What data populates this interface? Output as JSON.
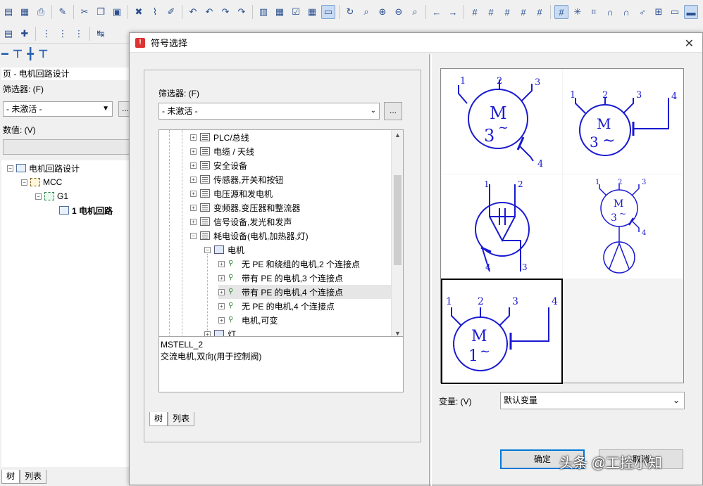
{
  "left_panel": {
    "page_title": "页 - 电机回路设计",
    "filter_label": "筛选器: (F)",
    "filter_value": "- 未激活 -",
    "more_label": "...",
    "value_label": "数值: (V)",
    "tree": [
      {
        "label": "电机回路设计",
        "level": 0,
        "expander": "−"
      },
      {
        "label": "MCC",
        "level": 1,
        "expander": "−"
      },
      {
        "label": "G1",
        "level": 2,
        "expander": "−"
      },
      {
        "label": "1 电机回路",
        "level": 3,
        "expander": ""
      }
    ],
    "tabs": [
      "树",
      "列表"
    ]
  },
  "dialog": {
    "title": "符号选择",
    "close": "✕",
    "filter_label": "筛选器: (F)",
    "filter_value": "- 未激活 -",
    "more_label": "...",
    "tree": [
      {
        "label": "PLC/总线",
        "level": 0,
        "expander": "+",
        "icon": "folder"
      },
      {
        "label": "电缆 / 天线",
        "level": 0,
        "expander": "+",
        "icon": "folder"
      },
      {
        "label": "安全设备",
        "level": 0,
        "expander": "+",
        "icon": "folder"
      },
      {
        "label": "传感器,开关和按钮",
        "level": 0,
        "expander": "+",
        "icon": "folder"
      },
      {
        "label": "电压源和发电机",
        "level": 0,
        "expander": "+",
        "icon": "folder"
      },
      {
        "label": "变频器,变压器和整流器",
        "level": 0,
        "expander": "+",
        "icon": "folder"
      },
      {
        "label": "信号设备,发光和发声",
        "level": 0,
        "expander": "+",
        "icon": "folder"
      },
      {
        "label": "耗电设备(电机,加热器,灯)",
        "level": 0,
        "expander": "−",
        "icon": "folder"
      },
      {
        "label": "电机",
        "level": 1,
        "expander": "−",
        "icon": "image"
      },
      {
        "label": "无 PE 和绕组的电机,2 个连接点",
        "level": 2,
        "expander": "+",
        "icon": "symbol"
      },
      {
        "label": "带有 PE 的电机,3 个连接点",
        "level": 2,
        "expander": "+",
        "icon": "symbol"
      },
      {
        "label": "带有 PE 的电机,4 个连接点",
        "level": 2,
        "expander": "+",
        "icon": "symbol",
        "highlight": true
      },
      {
        "label": "无 PE 的电机,4 个连接点",
        "level": 2,
        "expander": "+",
        "icon": "symbol"
      },
      {
        "label": "电机,可变",
        "level": 2,
        "expander": "+",
        "icon": "symbol"
      },
      {
        "label": "灯",
        "level": 1,
        "expander": "+",
        "icon": "image"
      }
    ],
    "symbol_name": "MSTELL_2",
    "symbol_description": "交流电机,双向(用于控制阀)",
    "tabs": [
      "树",
      "列表"
    ],
    "variant_label": "变量: (V)",
    "variant_value": "默认变量",
    "ok_label": "确定",
    "cancel_label": "取消"
  },
  "watermark": "头条 @工控小知",
  "colors": {
    "symbol": "#1a1ad0",
    "accent": "#0078d7"
  }
}
